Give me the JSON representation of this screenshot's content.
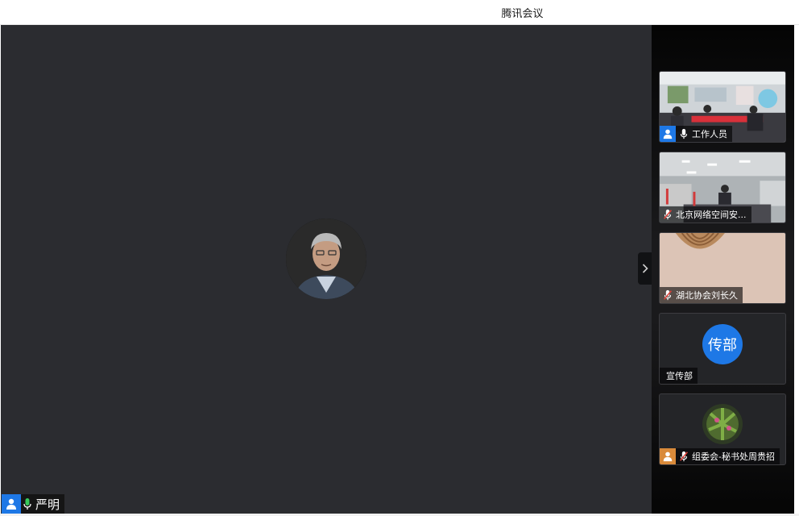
{
  "window": {
    "title": "腾讯会议"
  },
  "active_speaker": {
    "name": "严明",
    "avatar_icon": "person-photo",
    "mic_state": "on"
  },
  "participants": [
    {
      "label": "工作人员",
      "mic_state": "on",
      "has_user_badge": true,
      "badge_color": "#1e78e6",
      "video": "meeting-room"
    },
    {
      "label": "北京网络空间安...",
      "mic_state": "muted",
      "has_user_badge": false,
      "video": "office-room"
    },
    {
      "label": "湖北协会刘长久",
      "mic_state": "muted",
      "has_user_badge": false,
      "video": "wall-lamp"
    },
    {
      "label": "宣传部",
      "mic_state": "none",
      "has_user_badge": false,
      "avatar_text": "传部",
      "avatar_color": "#1e78e6"
    },
    {
      "label": "组委会-秘书处周贵招",
      "mic_state": "muted",
      "has_user_badge": true,
      "badge_color": "#d98a3a",
      "video": "plant-avatar"
    }
  ],
  "colors": {
    "stage_bg": "#2b2c30",
    "accent": "#1e78e6",
    "mic_on": "#37c85b",
    "mic_muted": "#e0443c"
  },
  "controls": {
    "collapse_icon": "chevron-right-icon"
  }
}
